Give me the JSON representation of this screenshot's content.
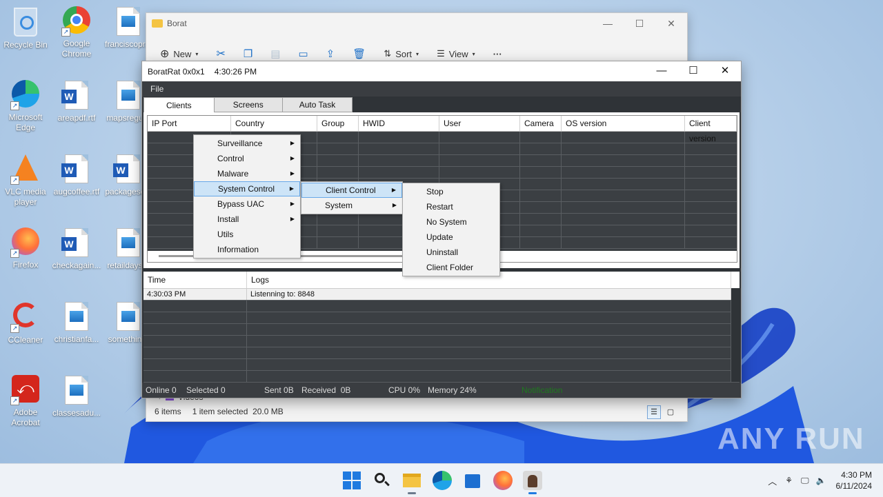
{
  "desktop": {
    "icons": [
      {
        "label": "Recycle Bin"
      },
      {
        "label": "Google Chrome"
      },
      {
        "label": "franciscopr..."
      },
      {
        "label": "Microsoft Edge"
      },
      {
        "label": "areapdf.rtf"
      },
      {
        "label": "mapsregu..."
      },
      {
        "label": "VLC media player"
      },
      {
        "label": "augcoffee.rtf"
      },
      {
        "label": "packagesc..."
      },
      {
        "label": "Firefox"
      },
      {
        "label": "checkagain..."
      },
      {
        "label": "retaildays..."
      },
      {
        "label": "CCleaner"
      },
      {
        "label": "christianfa..."
      },
      {
        "label": "somethin..."
      },
      {
        "label": "Adobe Acrobat"
      },
      {
        "label": "classesadu..."
      }
    ]
  },
  "explorer": {
    "title": "Borat",
    "toolbar": {
      "new": "New",
      "sort": "Sort",
      "view": "View",
      "more": "···"
    },
    "nav_item": "Videos",
    "status": {
      "items": "6 items",
      "selected": "1 item selected",
      "size": "20.0 MB"
    }
  },
  "rat": {
    "title": "BoratRat 0x0x1",
    "time": "4:30:26 PM",
    "menu": {
      "file": "File"
    },
    "tabs": [
      "Clients",
      "Screens",
      "Auto Task"
    ],
    "columns": [
      "IP Port",
      "Country",
      "Group",
      "HWID",
      "User",
      "Camera",
      "OS version",
      "Client version"
    ],
    "logs": {
      "columns": [
        "Time",
        "Logs"
      ],
      "rows": [
        {
          "time": "4:30:03 PM",
          "msg": "Listenning to: 8848"
        }
      ]
    },
    "status": {
      "online": "Online 0",
      "selected": "Selected 0",
      "sent": "Sent 0B",
      "received": "Received  0B",
      "cpu": "CPU 0%",
      "memory": "Memory 24%",
      "notification": "Notification"
    }
  },
  "context_menu": {
    "main": [
      "Surveillance",
      "Control",
      "Malware",
      "System Control",
      "Bypass UAC",
      "Install",
      "Utils",
      "Information"
    ],
    "system_control": [
      "Client Control",
      "System"
    ],
    "client_control": [
      "Stop",
      "Restart",
      "No System",
      "Update",
      "Uninstall",
      "Client Folder"
    ]
  },
  "taskbar": {
    "time": "4:30 PM",
    "date": "6/11/2024"
  },
  "watermark": "ANY RUN"
}
